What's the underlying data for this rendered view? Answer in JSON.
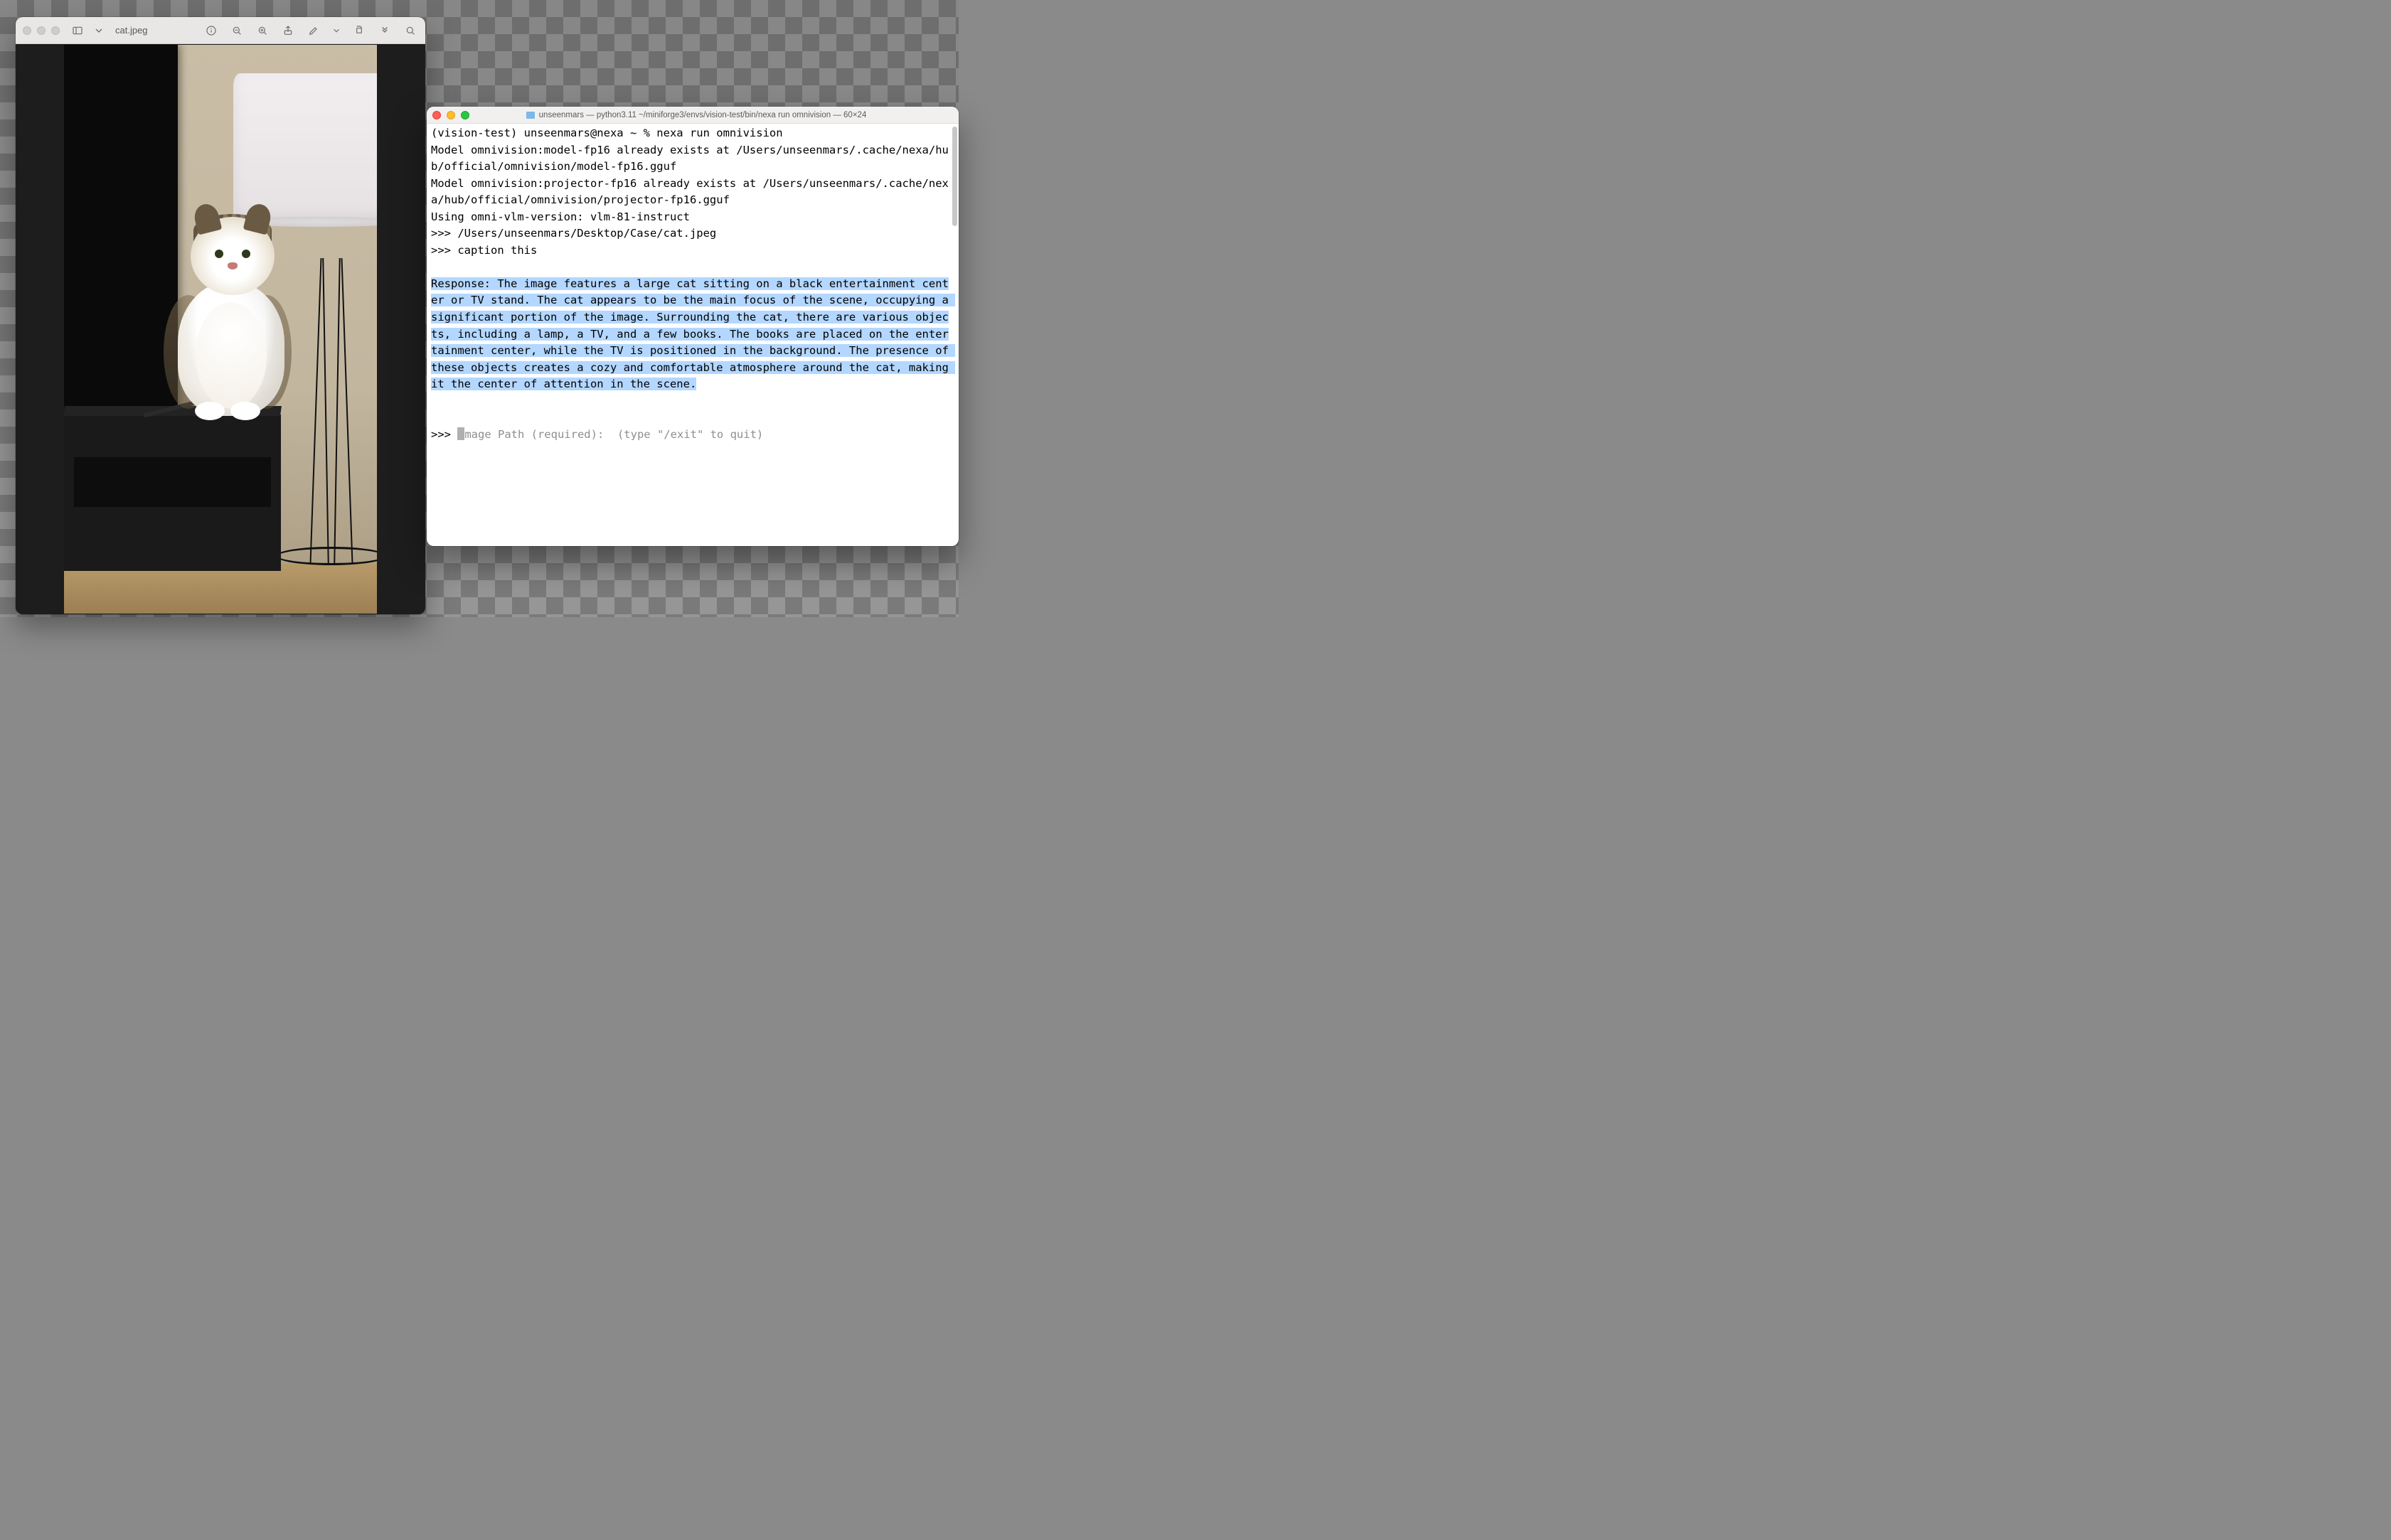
{
  "preview": {
    "filename": "cat.jpeg",
    "scene_description": "A fluffy brown-and-white tabby cat sits upright on a black TV stand next to a tall floor lamp with a large white drum shade, in front of a beige wall; the edge of a black TV is visible on the left."
  },
  "terminal": {
    "title": "unseenmars — python3.11 ~/miniforge3/envs/vision-test/bin/nexa run omnivision — 60×24",
    "prompt_prefix": ">>> ",
    "lines": {
      "l1": "(vision-test) unseenmars@nexa ~ % nexa run omnivision",
      "l2": "Model omnivision:model-fp16 already exists at /Users/unseenmars/.cache/nexa/hub/official/omnivision/model-fp16.gguf",
      "l3": "Model omnivision:projector-fp16 already exists at /Users/unseenmars/.cache/nexa/hub/official/omnivision/projector-fp16.gguf",
      "l4": "Using omni-vlm-version: vlm-81-instruct",
      "l5_path": "/Users/unseenmars/Desktop/Case/cat.jpeg",
      "l6_cmd": "caption this",
      "response": "Response: The image features a large cat sitting on a black entertainment center or TV stand. The cat appears to be the main focus of the scene, occupying a significant portion of the image. Surrounding the cat, there are various objects, including a lamp, a TV, and a few books. The books are placed on the entertainment center, while the TV is positioned in the background. The presence of these objects creates a cozy and comfortable atmosphere around the cat, making it the center of attention in the scene.",
      "next_prompt_hint": "mage Path (required):  (type \"/exit\" to quit)"
    }
  }
}
